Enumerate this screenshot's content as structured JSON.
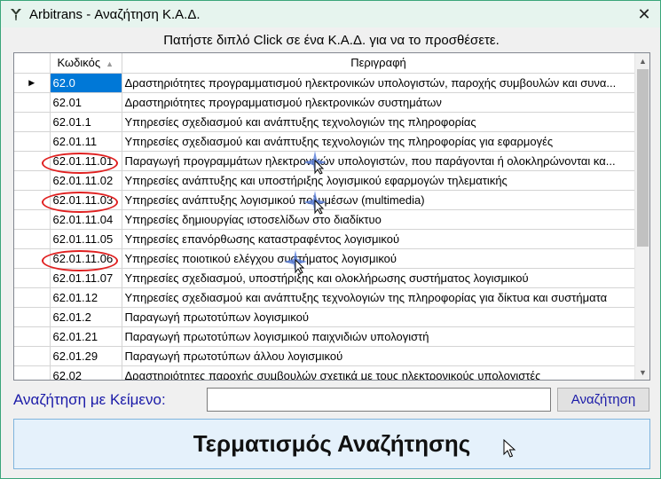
{
  "window": {
    "title": "Arbitrans - Αναζήτηση Κ.Α.Δ.",
    "close_glyph": "✕",
    "app_icon": "arbitrans-logo-icon"
  },
  "instruction": "Πατήστε διπλό Click σε ένα Κ.Α.Δ. για να το προσθέσετε.",
  "grid": {
    "columns": {
      "code": "Κωδικός",
      "description": "Περιγραφή"
    },
    "current_row_marker": "▶",
    "rows": [
      {
        "code": "62.0",
        "desc": "Δραστηριότητες προγραμματισμού ηλεκτρονικών υπολογιστών, παροχής συμβουλών και συνα...",
        "selected": true
      },
      {
        "code": "62.01",
        "desc": "Δραστηριότητες προγραμματισμού ηλεκτρονικών συστημάτων"
      },
      {
        "code": "62.01.1",
        "desc": "Υπηρεσίες σχεδιασμού και ανάπτυξης τεχνολογιών της πληροφορίας"
      },
      {
        "code": "62.01.11",
        "desc": "Υπηρεσίες σχεδιασμού και ανάπτυξης τεχνολογιών της πληροφορίας για εφαρμογές"
      },
      {
        "code": "62.01.11.01",
        "desc": "Παραγωγή προγραμμάτων ηλεκτρονικών υπολογιστών, που παράγονται ή ολοκληρώνονται κα...",
        "highlighted": true
      },
      {
        "code": "62.01.11.02",
        "desc": "Υπηρεσίες ανάπτυξης και υποστήριξης λογισμικού εφαρμογών τηλεματικής"
      },
      {
        "code": "62.01.11.03",
        "desc": "Υπηρεσίες ανάπτυξης λογισμικού πολυμέσων (multimedia)",
        "highlighted": true
      },
      {
        "code": "62.01.11.04",
        "desc": "Υπηρεσίες δημιουργίας ιστοσελίδων στο διαδίκτυο"
      },
      {
        "code": "62.01.11.05",
        "desc": "Υπηρεσίες επανόρθωσης καταστραφέντος λογισμικού"
      },
      {
        "code": "62.01.11.06",
        "desc": "Υπηρεσίες ποιοτικού ελέγχου συστήματος λογισμικού",
        "highlighted": true
      },
      {
        "code": "62.01.11.07",
        "desc": "Υπηρεσίες σχεδιασμού, υποστήριξης και ολοκλήρωσης συστήματος λογισμικού"
      },
      {
        "code": "62.01.12",
        "desc": "Υπηρεσίες σχεδιασμού και ανάπτυξης τεχνολογιών της πληροφορίας για δίκτυα και συστήματα"
      },
      {
        "code": "62.01.2",
        "desc": "Παραγωγή πρωτοτύπων λογισμικού"
      },
      {
        "code": "62.01.21",
        "desc": "Παραγωγή πρωτοτύπων λογισμικού παιχνιδιών υπολογιστή"
      },
      {
        "code": "62.01.29",
        "desc": "Παραγωγή πρωτοτύπων άλλου λογισμικού"
      },
      {
        "code": "62.02",
        "desc": "Δραστηριότητες παροχής συμβουλών σχετικά με τους ηλεκτρονικούς υπολογιστές"
      }
    ]
  },
  "search": {
    "label": "Αναζήτηση με Κείμενο:",
    "value": "",
    "button": "Αναζήτηση"
  },
  "end_button": "Τερματισμός Αναζήτησης",
  "colors": {
    "selection": "#0078d7",
    "annotation_circle": "#e02020",
    "label_blue": "#1a1aa8"
  }
}
